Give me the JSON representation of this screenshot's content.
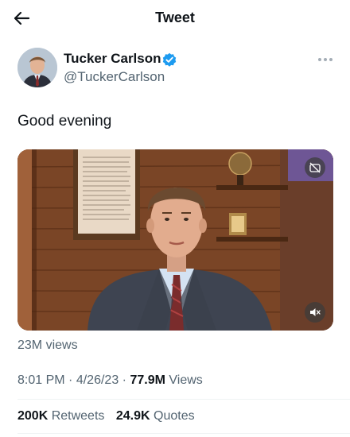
{
  "header": {
    "title": "Tweet"
  },
  "author": {
    "name": "Tucker Carlson",
    "handle": "@TuckerCarlson",
    "verified_color": "#1d9bf0"
  },
  "tweet": {
    "text": "Good evening",
    "video_views": "23M views",
    "time": "8:01 PM",
    "date": "4/26/23",
    "separator": "·",
    "views_count": "77.9M",
    "views_label": "Views"
  },
  "stats": {
    "retweets_count": "200K",
    "retweets_label": "Retweets",
    "quotes_count": "24.9K",
    "quotes_label": "Quotes"
  },
  "icons": {
    "back": "arrow-left-icon",
    "verified": "verified-badge-icon",
    "more": "more-horizontal-icon",
    "captions": "captions-off-icon",
    "mute": "volume-muted-icon"
  }
}
